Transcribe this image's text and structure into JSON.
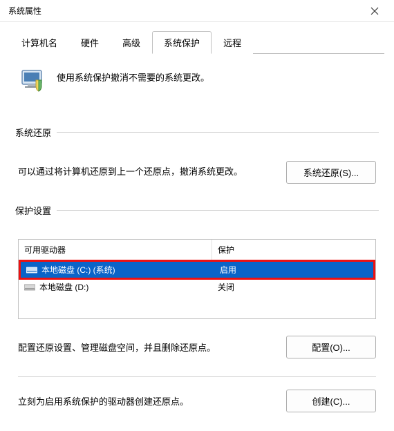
{
  "window": {
    "title": "系统属性"
  },
  "tabs": {
    "computerName": "计算机名",
    "hardware": "硬件",
    "advanced": "高级",
    "systemProtection": "系统保护",
    "remote": "远程"
  },
  "intro": "使用系统保护撤消不需要的系统更改。",
  "restore": {
    "sectionTitle": "系统还原",
    "description": "可以通过将计算机还原到上一个还原点，撤消系统更改。",
    "button": "系统还原(S)..."
  },
  "protection": {
    "sectionTitle": "保护设置",
    "header": {
      "drive": "可用驱动器",
      "protect": "保护"
    },
    "rows": [
      {
        "label": "本地磁盘 (C:) (系统)",
        "status": "启用",
        "selected": true
      },
      {
        "label": "本地磁盘 (D:)",
        "status": "关闭",
        "selected": false
      }
    ],
    "configureText": "配置还原设置、管理磁盘空间，并且删除还原点。",
    "configureButton": "配置(O)...",
    "createText": "立刻为启用系统保护的驱动器创建还原点。",
    "createButton": "创建(C)..."
  }
}
